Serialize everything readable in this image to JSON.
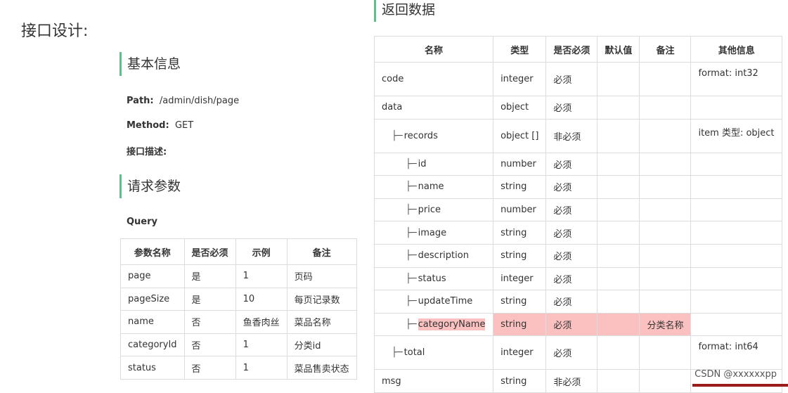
{
  "page_title": "接口设计:",
  "basic": {
    "heading": "基本信息",
    "path_label": "Path:",
    "path_value": "/admin/dish/page",
    "method_label": "Method:",
    "method_value": "GET",
    "desc_label": "接口描述:"
  },
  "request": {
    "heading": "请求参数",
    "query_label": "Query",
    "columns": [
      "参数名称",
      "是否必须",
      "示例",
      "备注"
    ],
    "rows": [
      [
        "page",
        "是",
        "1",
        "页码"
      ],
      [
        "pageSize",
        "是",
        "10",
        "每页记录数"
      ],
      [
        "name",
        "否",
        "鱼香肉丝",
        "菜品名称"
      ],
      [
        "categoryId",
        "否",
        "1",
        "分类id"
      ],
      [
        "status",
        "否",
        "1",
        "菜品售卖状态"
      ]
    ]
  },
  "response": {
    "heading": "返回数据",
    "columns": [
      "名称",
      "类型",
      "是否必须",
      "默认值",
      "备注",
      "其他信息"
    ],
    "rows": [
      {
        "name": "code",
        "type": "integer",
        "required": "必须",
        "default": "",
        "note": "",
        "other": "format: int32"
      },
      {
        "name": "data",
        "type": "object",
        "required": "必须",
        "default": "",
        "note": "",
        "other": ""
      },
      {
        "name": "records",
        "type": "object []",
        "required": "非必须",
        "default": "",
        "note": "",
        "other": "item 类型: object"
      },
      {
        "name": "id",
        "type": "number",
        "required": "必须",
        "default": "",
        "note": "",
        "other": ""
      },
      {
        "name": "name",
        "type": "string",
        "required": "必须",
        "default": "",
        "note": "",
        "other": ""
      },
      {
        "name": "price",
        "type": "number",
        "required": "必须",
        "default": "",
        "note": "",
        "other": ""
      },
      {
        "name": "image",
        "type": "string",
        "required": "必须",
        "default": "",
        "note": "",
        "other": ""
      },
      {
        "name": "description",
        "type": "string",
        "required": "必须",
        "default": "",
        "note": "",
        "other": ""
      },
      {
        "name": "status",
        "type": "integer",
        "required": "必须",
        "default": "",
        "note": "",
        "other": ""
      },
      {
        "name": "updateTime",
        "type": "string",
        "required": "必须",
        "default": "",
        "note": "",
        "other": ""
      },
      {
        "name": "categoryName",
        "type": "string",
        "required": "必须",
        "default": "",
        "note": "分类名称",
        "other": ""
      },
      {
        "name": "total",
        "type": "integer",
        "required": "必须",
        "default": "",
        "note": "",
        "other": "format: int64"
      },
      {
        "name": "msg",
        "type": "string",
        "required": "非必须",
        "default": "",
        "note": "",
        "other": ""
      }
    ]
  },
  "tree_glyph": "├─",
  "watermark": "CSDN @xxxxxxpp",
  "colors": {
    "accent_bar": "#5fbf8a",
    "highlight": "#fbc1c1",
    "border": "#dcdcdc"
  }
}
